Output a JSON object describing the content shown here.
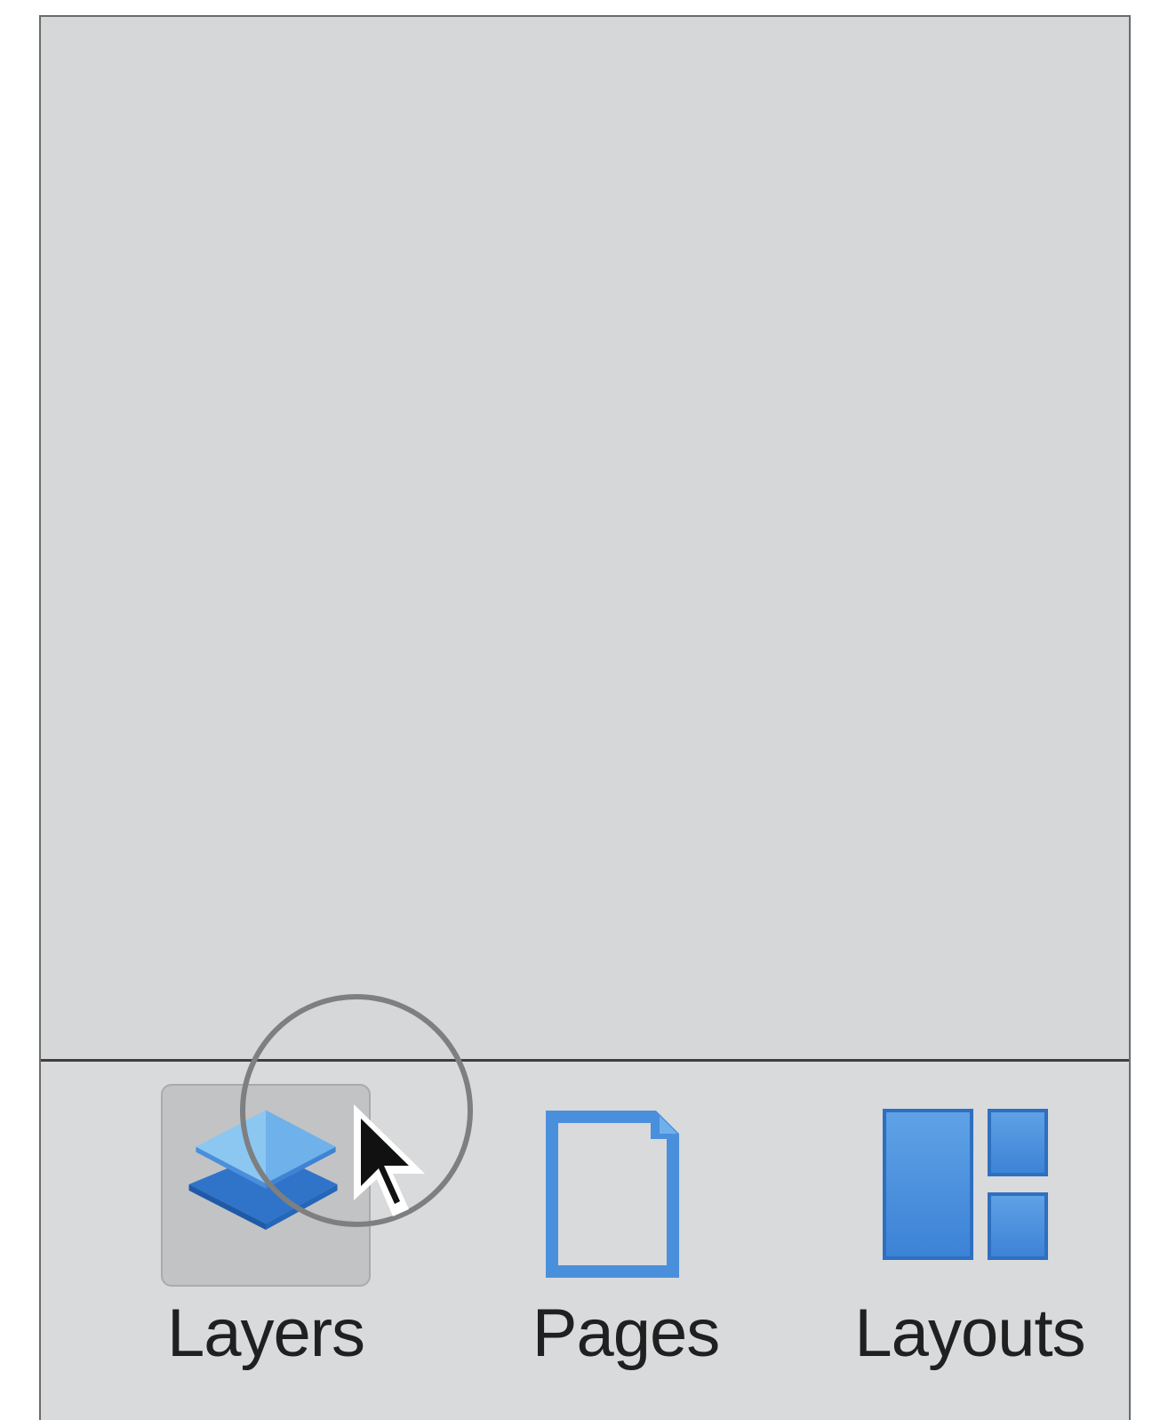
{
  "tabs": [
    {
      "id": "layers",
      "label": "Layers",
      "icon": "layers-icon",
      "selected": true
    },
    {
      "id": "pages",
      "label": "Pages",
      "icon": "page-icon",
      "selected": false
    },
    {
      "id": "layouts",
      "label": "Layouts",
      "icon": "layouts-icon",
      "selected": false
    }
  ],
  "colors": {
    "panel_background": "#d5d7d8",
    "selected_tab_background": "#c2c3c4",
    "icon_blue": "#4a8fdc",
    "icon_light_blue": "#8cc7f2",
    "highlight_ring": "#7d7f80"
  }
}
